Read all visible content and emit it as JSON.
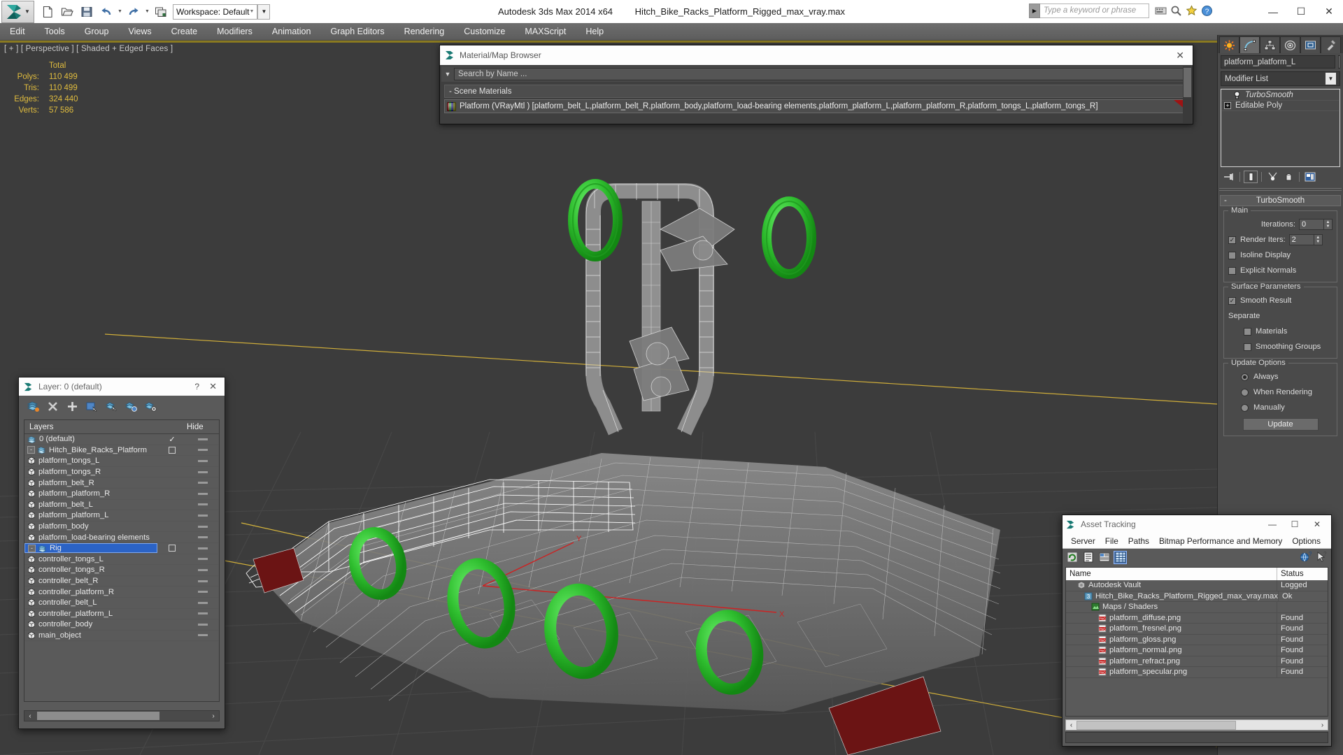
{
  "titlebar": {
    "workspace_label": "Workspace: Default",
    "app_title": "Autodesk 3ds Max  2014 x64",
    "file_title": "Hitch_Bike_Racks_Platform_Rigged_max_vray.max",
    "search_placeholder": "Type a keyword or phrase",
    "minimize": "—",
    "maximize": "☐",
    "close": "✕"
  },
  "menubar": {
    "items": [
      "Edit",
      "Tools",
      "Group",
      "Views",
      "Create",
      "Modifiers",
      "Animation",
      "Graph Editors",
      "Rendering",
      "Customize",
      "MAXScript",
      "Help"
    ]
  },
  "viewport": {
    "label": "[ + ] [ Perspective ] [ Shaded + Edged Faces ]",
    "stats": {
      "header": "Total",
      "rows": [
        {
          "label": "Polys:",
          "value": "110 499"
        },
        {
          "label": "Tris:",
          "value": "110 499"
        },
        {
          "label": "Edges:",
          "value": "324 440"
        },
        {
          "label": "Verts:",
          "value": "57 586"
        }
      ]
    }
  },
  "material_browser": {
    "title": "Material/Map Browser",
    "search_placeholder": "Search by Name ...",
    "section": "- Scene Materials",
    "material_row": "Platform (VRayMtl ) [platform_belt_L,platform_belt_R,platform_body,platform_load-bearing elements,platform_platform_L,platform_platform_R,platform_tongs_L,platform_tongs_R]"
  },
  "layer_dialog": {
    "title": "Layer: 0 (default)",
    "help": "?",
    "close": "✕",
    "col_layers": "Layers",
    "col_hide": "Hide",
    "rows": [
      {
        "name": "0 (default)",
        "indent": 1,
        "type": "layer",
        "expander": false,
        "check": "tick",
        "selected": false
      },
      {
        "name": "Hitch_Bike_Racks_Platform",
        "indent": 0,
        "type": "layer",
        "expander": true,
        "check": "box",
        "selected": false
      },
      {
        "name": "platform_tongs_L",
        "indent": 2,
        "type": "object",
        "expander": false,
        "check": "",
        "selected": false
      },
      {
        "name": "platform_tongs_R",
        "indent": 2,
        "type": "object",
        "expander": false,
        "check": "",
        "selected": false
      },
      {
        "name": "platform_belt_R",
        "indent": 2,
        "type": "object",
        "expander": false,
        "check": "",
        "selected": false
      },
      {
        "name": "platform_platform_R",
        "indent": 2,
        "type": "object",
        "expander": false,
        "check": "",
        "selected": false
      },
      {
        "name": "platform_belt_L",
        "indent": 2,
        "type": "object",
        "expander": false,
        "check": "",
        "selected": false
      },
      {
        "name": "platform_platform_L",
        "indent": 2,
        "type": "object",
        "expander": false,
        "check": "",
        "selected": false
      },
      {
        "name": "platform_body",
        "indent": 2,
        "type": "object",
        "expander": false,
        "check": "",
        "selected": false
      },
      {
        "name": "platform_load-bearing elements",
        "indent": 2,
        "type": "object",
        "expander": false,
        "check": "",
        "selected": false
      },
      {
        "name": "Rig",
        "indent": 0,
        "type": "layer",
        "expander": true,
        "check": "box",
        "selected": true
      },
      {
        "name": "controller_tongs_L",
        "indent": 2,
        "type": "object",
        "expander": false,
        "check": "",
        "selected": false
      },
      {
        "name": "controller_tongs_R",
        "indent": 2,
        "type": "object",
        "expander": false,
        "check": "",
        "selected": false
      },
      {
        "name": "controller_belt_R",
        "indent": 2,
        "type": "object",
        "expander": false,
        "check": "",
        "selected": false
      },
      {
        "name": "controller_platform_R",
        "indent": 2,
        "type": "object",
        "expander": false,
        "check": "",
        "selected": false
      },
      {
        "name": "controller_belt_L",
        "indent": 2,
        "type": "object",
        "expander": false,
        "check": "",
        "selected": false
      },
      {
        "name": "controller_platform_L",
        "indent": 2,
        "type": "object",
        "expander": false,
        "check": "",
        "selected": false
      },
      {
        "name": "controller_body",
        "indent": 2,
        "type": "object",
        "expander": false,
        "check": "",
        "selected": false
      },
      {
        "name": "main_object",
        "indent": 2,
        "type": "object",
        "expander": false,
        "check": "",
        "selected": false
      }
    ]
  },
  "command_panel": {
    "object_name": "platform_platform_L",
    "modifier_list_label": "Modifier List",
    "stack": [
      {
        "label": "TurboSmooth",
        "italic": true,
        "icon": "bulb-icon"
      },
      {
        "label": "Editable Poly",
        "italic": false,
        "icon": "plus-icon"
      }
    ],
    "rollout_title": "TurboSmooth",
    "rollout_minus": "-",
    "groups": {
      "main": {
        "caption": "Main",
        "iterations_label": "Iterations:",
        "iterations_value": "0",
        "render_iters_label": "Render Iters:",
        "render_iters_value": "2",
        "render_iters_checked": true,
        "isoline_label": "Isoline Display",
        "isoline_checked": false,
        "explicit_label": "Explicit Normals",
        "explicit_checked": false
      },
      "surface": {
        "caption": "Surface Parameters",
        "smooth_result_label": "Smooth Result",
        "smooth_result_checked": true,
        "separate_label": "Separate",
        "materials_label": "Materials",
        "materials_checked": false,
        "smoothing_groups_label": "Smoothing Groups",
        "smoothing_groups_checked": false
      },
      "update": {
        "caption": "Update Options",
        "always_label": "Always",
        "when_rendering_label": "When Rendering",
        "manually_label": "Manually",
        "selected": "Always",
        "update_button": "Update"
      }
    }
  },
  "asset_tracking": {
    "title": "Asset Tracking",
    "minimize": "—",
    "maximize": "☐",
    "close": "✕",
    "menu": [
      "Server",
      "File",
      "Paths",
      "Bitmap Performance and Memory",
      "Options"
    ],
    "col_name": "Name",
    "col_status": "Status",
    "rows": [
      {
        "name": "Autodesk Vault",
        "status": "Logged",
        "indent": 1,
        "icon": "vault-icon"
      },
      {
        "name": "Hitch_Bike_Racks_Platform_Rigged_max_vray.max",
        "status": "Ok",
        "indent": 2,
        "icon": "max-file-icon"
      },
      {
        "name": "Maps / Shaders",
        "status": "",
        "indent": 3,
        "icon": "maps-icon"
      },
      {
        "name": "platform_diffuse.png",
        "status": "Found",
        "indent": 4,
        "icon": "png-icon"
      },
      {
        "name": "platform_fresnel.png",
        "status": "Found",
        "indent": 4,
        "icon": "png-icon"
      },
      {
        "name": "platform_gloss.png",
        "status": "Found",
        "indent": 4,
        "icon": "png-icon"
      },
      {
        "name": "platform_normal.png",
        "status": "Found",
        "indent": 4,
        "icon": "png-icon"
      },
      {
        "name": "platform_refract.png",
        "status": "Found",
        "indent": 4,
        "icon": "png-icon"
      },
      {
        "name": "platform_specular.png",
        "status": "Found",
        "indent": 4,
        "icon": "png-icon"
      }
    ],
    "scroll_left": "‹",
    "scroll_right": "›"
  },
  "colors": {
    "accent_green": "#33c933",
    "stats_yellow": "#e0bc3e",
    "selection_blue": "#2b63c6",
    "viewport_bg": "#3c3c3c",
    "grid_line": "#4f4f4f",
    "axis_yellow": "#d6b53c",
    "panel_bg": "#4a4a4a"
  }
}
